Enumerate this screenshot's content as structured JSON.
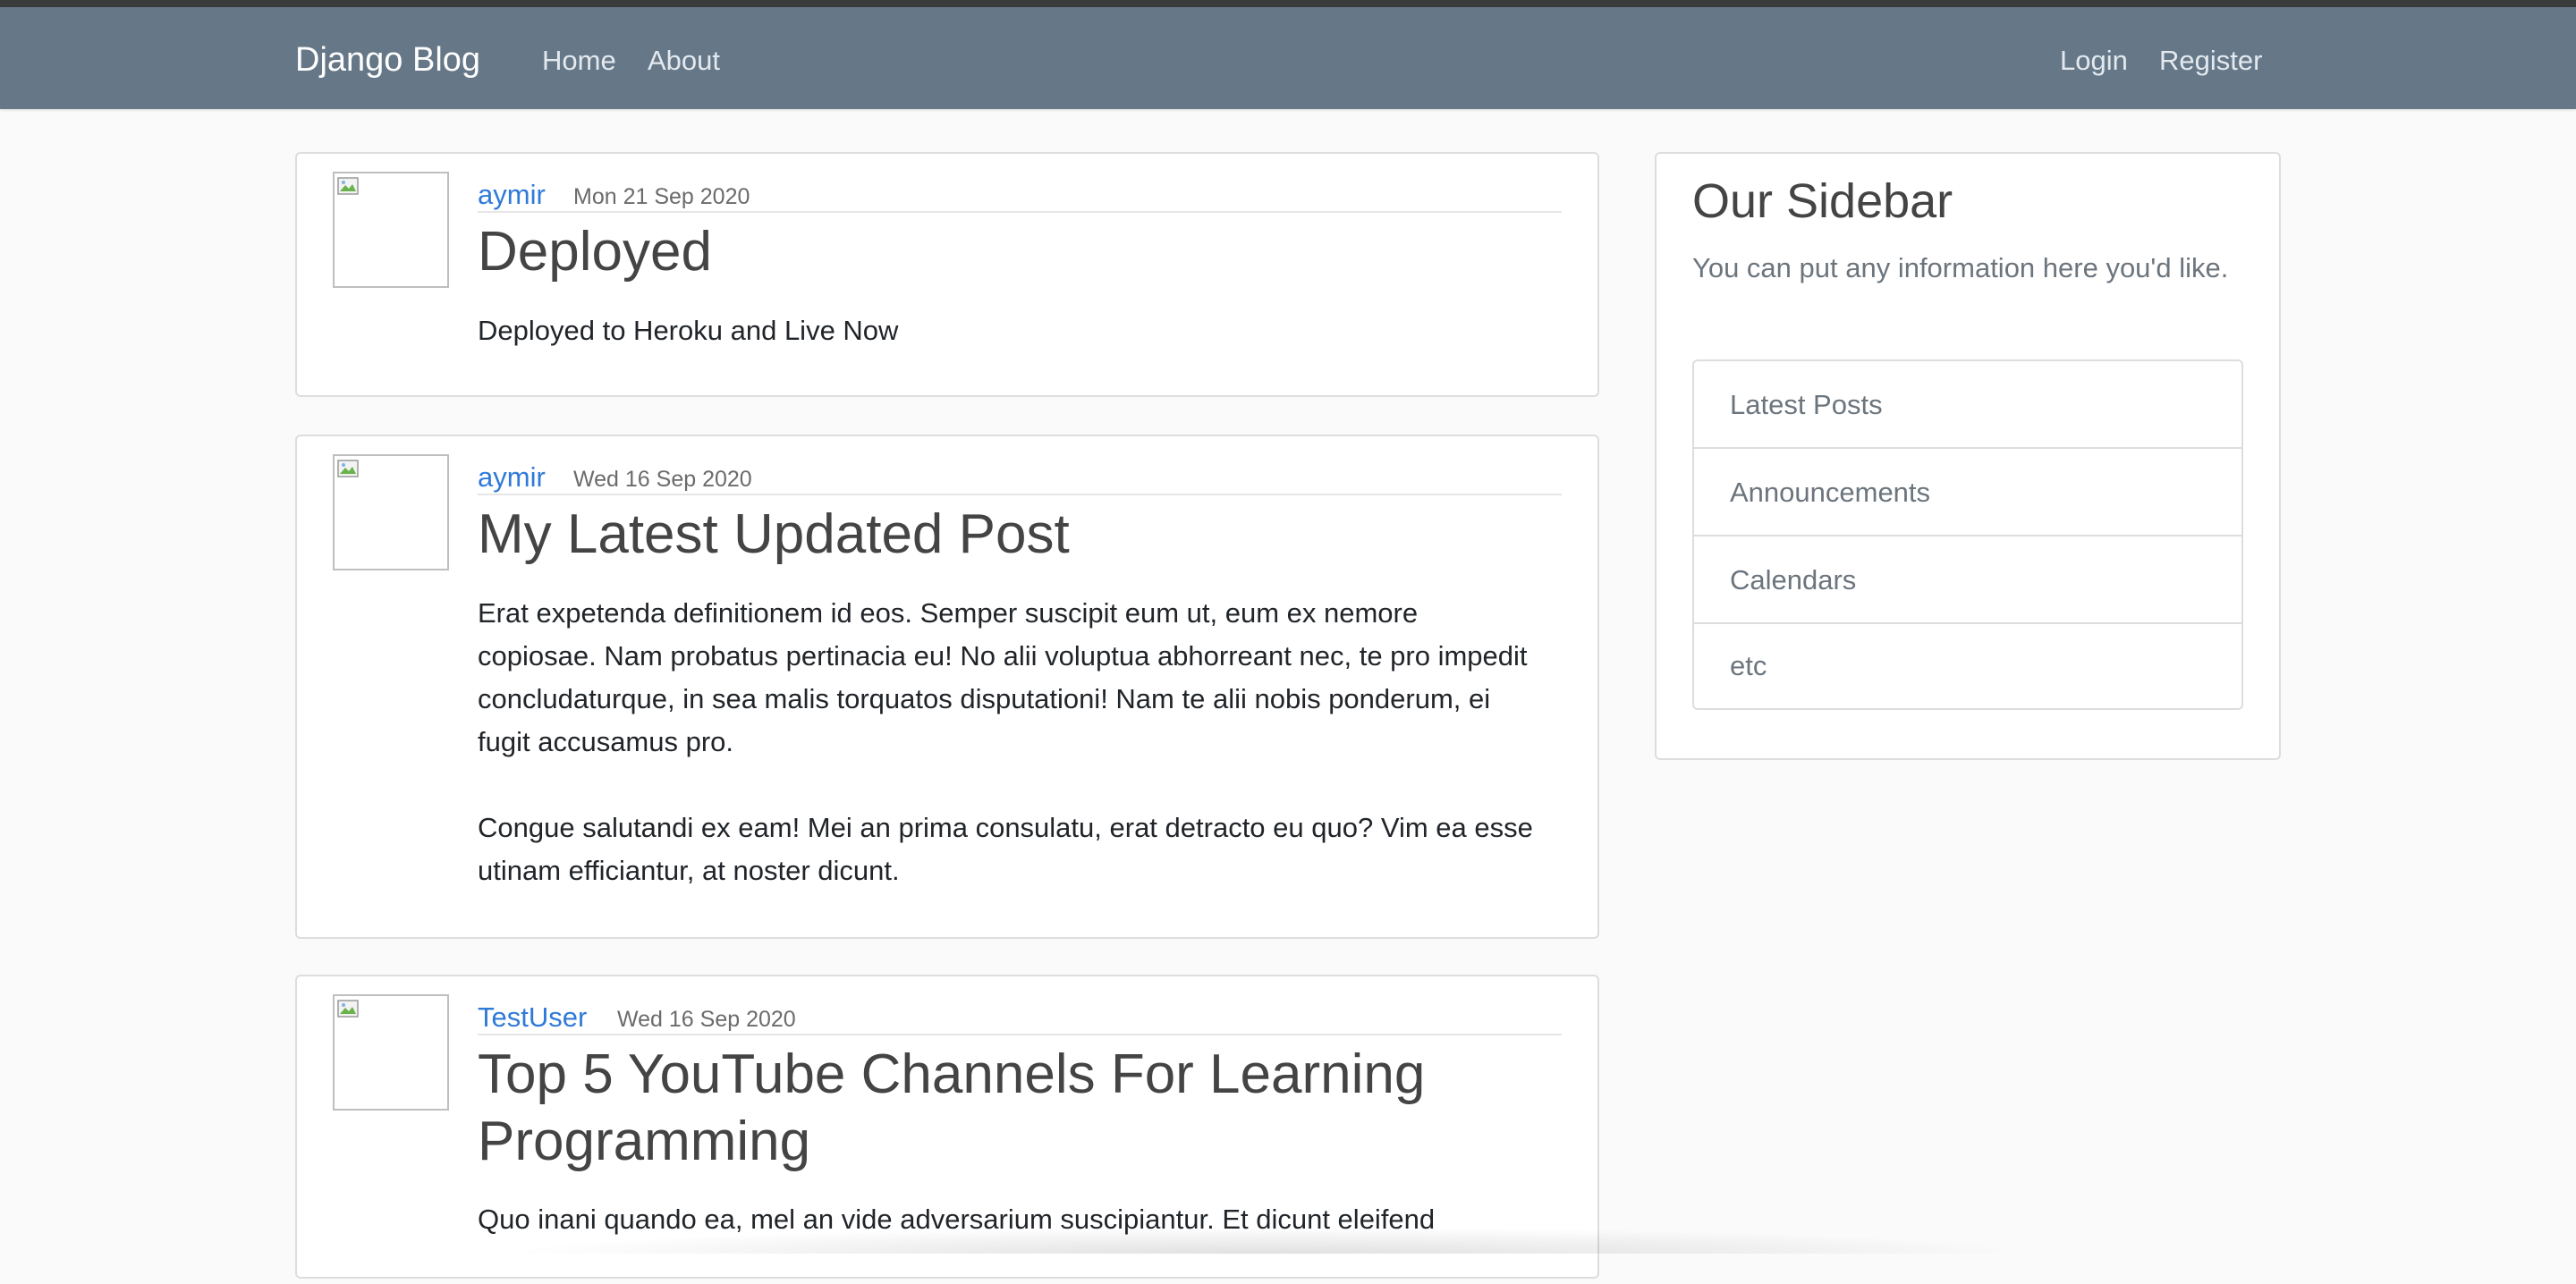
{
  "nav": {
    "brand": "Django Blog",
    "links": [
      "Home",
      "About"
    ],
    "auth": [
      "Login",
      "Register"
    ]
  },
  "posts": [
    {
      "author": "aymir",
      "date": "Mon 21 Sep 2020",
      "title": "Deployed",
      "body": [
        "Deployed to Heroku and Live Now"
      ]
    },
    {
      "author": "aymir",
      "date": "Wed 16 Sep 2020",
      "title": "My Latest Updated Post",
      "body": [
        "Erat expetenda definitionem id eos. Semper suscipit eum ut, eum ex nemore copiosae. Nam probatus pertinacia eu! No alii voluptua abhorreant nec, te pro impedit concludaturque, in sea malis torquatos disputationi! Nam te alii nobis ponderum, ei fugit accusamus pro.",
        "Congue salutandi ex eam! Mei an prima consulatu, erat detracto eu quo? Vim ea esse utinam efficiantur, at noster dicunt."
      ]
    },
    {
      "author": "TestUser",
      "date": "Wed 16 Sep 2020",
      "title": "Top 5 YouTube Channels For Learning Programming",
      "body": [
        "Quo inani quando ea, mel an vide adversarium suscipiantur. Et dicunt eleifend"
      ]
    }
  ],
  "sidebar": {
    "title": "Our Sidebar",
    "description": "You can put any information here you'd like.",
    "items": [
      "Latest Posts",
      "Announcements",
      "Calendars",
      "etc"
    ]
  },
  "colors": {
    "navbar": "#667888",
    "link": "#2f7ad9"
  },
  "icons": {
    "avatar": "broken-image-icon"
  }
}
